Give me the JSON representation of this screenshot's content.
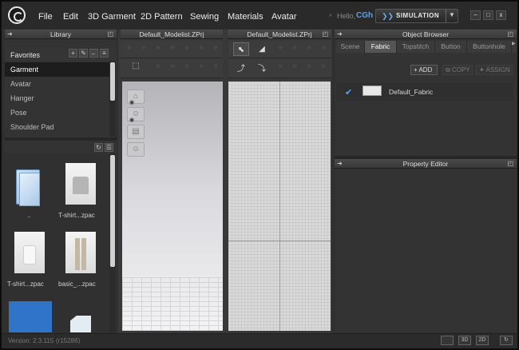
{
  "app": {
    "menu": [
      "File",
      "Edit",
      "3D Garment",
      "2D Pattern",
      "Sewing",
      "Materials",
      "Avatar"
    ],
    "greeting": "Hello,",
    "username": "CGh",
    "simulation_label": "SIMULATION",
    "window_controls": [
      "–",
      "□",
      "x"
    ]
  },
  "library": {
    "title": "Library",
    "favorites_label": "Favorites",
    "items": [
      "Garment",
      "Avatar",
      "Hanger",
      "Pose",
      "Shoulder Pad"
    ],
    "files": [
      {
        "name": "..",
        "icon": "folder-icon"
      },
      {
        "name": "T-shirt...zpac",
        "icon": "tshirt-thumbnail"
      },
      {
        "name": "T-shirt...zpac",
        "icon": "tshirt-thumbnail"
      },
      {
        "name": "basic_...zpac",
        "icon": "pants-thumbnail"
      },
      {
        "name": "",
        "icon": "blue-tile-thumbnail"
      },
      {
        "name": "",
        "icon": "page-thumbnail"
      }
    ]
  },
  "viewport3d": {
    "title": "Default_Modelist.ZPrj"
  },
  "viewport2d": {
    "title": "Default_Modelist.ZPrj"
  },
  "object_browser": {
    "title": "Object Browser",
    "tabs": [
      "Scene",
      "Fabric",
      "Topstitch",
      "Button",
      "Buttonhole"
    ],
    "active_tab": "Fabric",
    "actions": [
      "ADD",
      "COPY",
      "ASSIGN"
    ],
    "fabrics": [
      {
        "name": "Default_Fabric",
        "checked": true
      }
    ]
  },
  "property_editor": {
    "title": "Property Editor"
  },
  "status": {
    "version": "Version: 2.3.115",
    "build": "(r15286)",
    "view_buttons": [
      "",
      "3D",
      "2D",
      "↻"
    ]
  },
  "colors": {
    "accent": "#57a6ff",
    "username": "#5fa0e6",
    "panel": "#333333"
  }
}
